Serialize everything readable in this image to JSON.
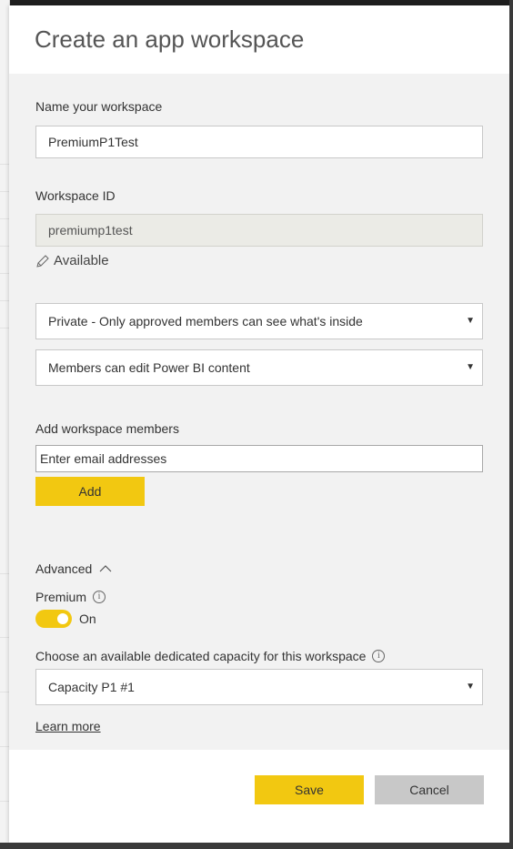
{
  "dialog": {
    "title": "Create an app workspace"
  },
  "form": {
    "name_label": "Name your workspace",
    "name_value": "PremiumP1Test",
    "id_label": "Workspace ID",
    "id_value": "premiump1test",
    "availability": "Available",
    "privacy_select": "Private - Only approved members can see what's inside",
    "permission_select": "Members can edit Power BI content",
    "members_label": "Add workspace members",
    "email_placeholder": "Enter email addresses",
    "add_button": "Add",
    "advanced_label": "Advanced",
    "premium_label": "Premium",
    "premium_toggle_state": "On",
    "premium_toggle_on": true,
    "capacity_label": "Choose an available dedicated capacity for this workspace",
    "capacity_select": "Capacity P1 #1",
    "learn_more": "Learn more"
  },
  "footer": {
    "save_button": "Save",
    "cancel_button": "Cancel"
  },
  "icons": {
    "pencil": "pencil-icon",
    "dropdown": "chevron-down-icon",
    "chevron_up": "chevron-up-icon",
    "info": "info-icon"
  },
  "colors": {
    "accent": "#f2c811",
    "form_background": "#f2f2f2",
    "cancel": "#c8c8c8"
  }
}
